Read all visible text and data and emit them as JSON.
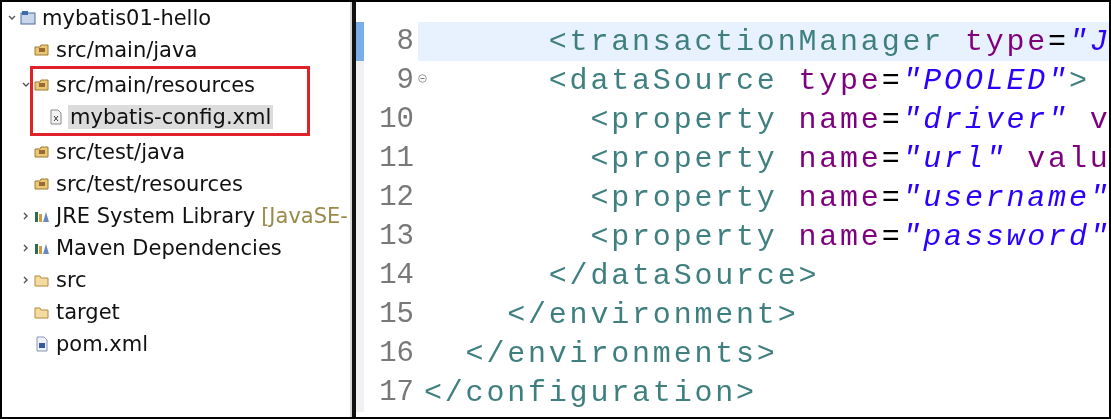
{
  "project_tree": {
    "items": [
      {
        "label": "mybatis01-hello",
        "kind": "project",
        "expanded": true,
        "selected": false,
        "children": [
          {
            "label": "src/main/java",
            "kind": "package-folder",
            "selected": false
          },
          {
            "label": "src/main/resources",
            "kind": "package-folder",
            "expanded": true,
            "selected": false,
            "highlighted": true,
            "children": [
              {
                "label": "mybatis-config.xml",
                "kind": "xml-file",
                "selected": true
              }
            ]
          },
          {
            "label": "src/test/java",
            "kind": "package-folder",
            "selected": false
          },
          {
            "label": "src/test/resources",
            "kind": "package-folder",
            "selected": false
          },
          {
            "label": "JRE System Library",
            "decoration": "[JavaSE-",
            "kind": "library",
            "expanded": false,
            "selected": false
          },
          {
            "label": "Maven Dependencies",
            "kind": "library",
            "expanded": false,
            "selected": false
          },
          {
            "label": "src",
            "kind": "folder",
            "expanded": false,
            "selected": false
          },
          {
            "label": "target",
            "kind": "folder",
            "selected": false
          },
          {
            "label": "pom.xml",
            "kind": "pom-file",
            "selected": false
          }
        ]
      }
    ]
  },
  "editor": {
    "lines": [
      {
        "number": "8",
        "current": true,
        "tokens": [
          {
            "kind": "tag",
            "text": "      <transactionManager "
          },
          {
            "kind": "attr",
            "text": "type"
          },
          {
            "kind": "plain",
            "text": "="
          },
          {
            "kind": "value",
            "text": "\"J"
          }
        ]
      },
      {
        "number": "9",
        "current": false,
        "foldable": true,
        "tokens": [
          {
            "kind": "tag",
            "text": "      <dataSource "
          },
          {
            "kind": "attr",
            "text": "type"
          },
          {
            "kind": "plain",
            "text": "="
          },
          {
            "kind": "value",
            "text": "\"POOLED\""
          },
          {
            "kind": "tag",
            "text": ">"
          }
        ]
      },
      {
        "number": "10",
        "current": false,
        "tokens": [
          {
            "kind": "tag",
            "text": "        <property "
          },
          {
            "kind": "attr",
            "text": "name"
          },
          {
            "kind": "plain",
            "text": "="
          },
          {
            "kind": "value",
            "text": "\"driver\" "
          },
          {
            "kind": "attr",
            "text": "v"
          }
        ]
      },
      {
        "number": "11",
        "current": false,
        "tokens": [
          {
            "kind": "tag",
            "text": "        <property "
          },
          {
            "kind": "attr",
            "text": "name"
          },
          {
            "kind": "plain",
            "text": "="
          },
          {
            "kind": "value",
            "text": "\"url\" "
          },
          {
            "kind": "attr",
            "text": "valu"
          }
        ]
      },
      {
        "number": "12",
        "current": false,
        "tokens": [
          {
            "kind": "tag",
            "text": "        <property "
          },
          {
            "kind": "attr",
            "text": "name"
          },
          {
            "kind": "plain",
            "text": "="
          },
          {
            "kind": "value",
            "text": "\"username\""
          }
        ]
      },
      {
        "number": "13",
        "current": false,
        "tokens": [
          {
            "kind": "tag",
            "text": "        <property "
          },
          {
            "kind": "attr",
            "text": "name"
          },
          {
            "kind": "plain",
            "text": "="
          },
          {
            "kind": "value",
            "text": "\"password\""
          }
        ]
      },
      {
        "number": "14",
        "current": false,
        "tokens": [
          {
            "kind": "tag",
            "text": "      </dataSource>"
          }
        ]
      },
      {
        "number": "15",
        "current": false,
        "tokens": [
          {
            "kind": "tag",
            "text": "    </environment>"
          }
        ]
      },
      {
        "number": "16",
        "current": false,
        "tokens": [
          {
            "kind": "tag",
            "text": "  </environments>"
          }
        ]
      },
      {
        "number": "17",
        "current": false,
        "tokens": [
          {
            "kind": "tag",
            "text": "</configuration>"
          }
        ]
      }
    ]
  }
}
